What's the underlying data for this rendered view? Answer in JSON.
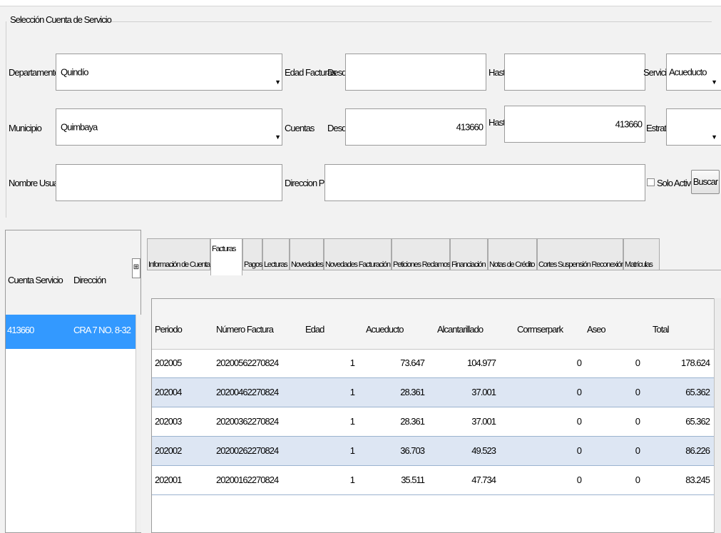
{
  "filters": {
    "group_title": "Selección Cuenta de Servicio",
    "departamento_label": "Departamento",
    "departamento_value": "Quindío",
    "municipio_label": "Municipio",
    "municipio_value": "Quimbaya",
    "nombre_usuario_label": "Nombre Usuario",
    "nombre_usuario_value": "",
    "edad_facturas_label": "Edad Facturas",
    "cuentas_label": "Cuentas",
    "desde_label": "Desde",
    "hasta_label": "Hasta",
    "edad_desde_value": "",
    "edad_hasta_value": "",
    "cuentas_desde_value": "413660",
    "cuentas_hasta_value": "413660",
    "direccion_label": "Direccion Predio",
    "direccion_value": "",
    "servicio_label": "Servicio",
    "servicio_value": "Acueducto",
    "estrato_label": "Estrato",
    "estrato_value": "",
    "solo_activos_label": "Solo Activos",
    "buscar_label": "Buscar"
  },
  "accounts": {
    "col_cuenta": "Cuenta Servicio",
    "col_direccion": "Dirección",
    "rows": [
      {
        "cuenta": "413660",
        "direccion": "CRA 7 NO. 8-32"
      }
    ]
  },
  "tabs": [
    {
      "label": "Información de Cuenta"
    },
    {
      "label": "Facturas"
    },
    {
      "label": "Pagos"
    },
    {
      "label": "Lecturas"
    },
    {
      "label": "Novedades"
    },
    {
      "label": "Novedades Facturación"
    },
    {
      "label": "Peticiones Reclamos"
    },
    {
      "label": "Financiación"
    },
    {
      "label": "Notas de Crédito"
    },
    {
      "label": "Cortes Suspensión Reconexión"
    },
    {
      "label": "Matrículas"
    }
  ],
  "invoices": {
    "columns": [
      "Periodo",
      "Número Factura",
      "Edad",
      "Acueducto",
      "Alcantarillado",
      "Cormserpark",
      "Aseo",
      "Total"
    ],
    "rows": [
      {
        "periodo": "202005",
        "numero": "20200562270824",
        "edad": "1",
        "acueducto": "73.647",
        "alcantarillado": "104.977",
        "cormserpark": "0",
        "aseo": "0",
        "total": "178.624"
      },
      {
        "periodo": "202004",
        "numero": "20200462270824",
        "edad": "1",
        "acueducto": "28.361",
        "alcantarillado": "37.001",
        "cormserpark": "0",
        "aseo": "0",
        "total": "65.362"
      },
      {
        "periodo": "202003",
        "numero": "20200362270824",
        "edad": "1",
        "acueducto": "28.361",
        "alcantarillado": "37.001",
        "cormserpark": "0",
        "aseo": "0",
        "total": "65.362"
      },
      {
        "periodo": "202002",
        "numero": "20200262270824",
        "edad": "1",
        "acueducto": "36.703",
        "alcantarillado": "49.523",
        "cormserpark": "0",
        "aseo": "0",
        "total": "86.226"
      },
      {
        "periodo": "202001",
        "numero": "20200162270824",
        "edad": "1",
        "acueducto": "35.511",
        "alcantarillado": "47.734",
        "cormserpark": "0",
        "aseo": "0",
        "total": "83.245"
      }
    ]
  },
  "icons": {
    "combo_arrow": "▼",
    "pin": "⊞"
  }
}
